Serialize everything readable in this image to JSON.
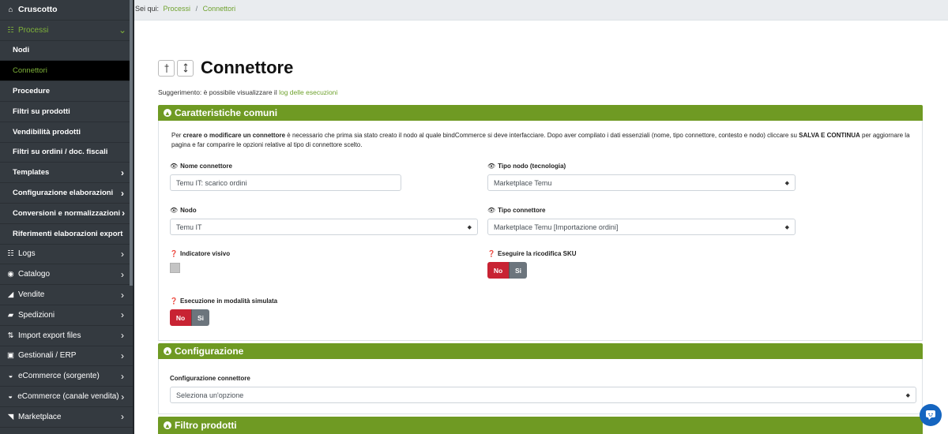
{
  "sidebar": {
    "items": [
      {
        "label": "Cruscotto",
        "icon": "home-icon",
        "glyph": "⌂",
        "kind": "top",
        "chevron": ""
      },
      {
        "label": "Processi",
        "icon": "processes-icon",
        "glyph": "☷",
        "kind": "open",
        "chevron": "⌄"
      },
      {
        "label": "Nodi",
        "kind": "sub",
        "chevron": ""
      },
      {
        "label": "Connettori",
        "kind": "sub-active",
        "chevron": ""
      },
      {
        "label": "Procedure",
        "kind": "sub",
        "chevron": ""
      },
      {
        "label": "Filtri su prodotti",
        "kind": "sub",
        "chevron": ""
      },
      {
        "label": "Vendibilità prodotti",
        "kind": "sub",
        "chevron": ""
      },
      {
        "label": "Filtri su ordini / doc. fiscali",
        "kind": "sub",
        "chevron": ""
      },
      {
        "label": "Templates",
        "kind": "sub",
        "chevron": "›"
      },
      {
        "label": "Configurazione elaborazioni",
        "kind": "sub",
        "chevron": "›"
      },
      {
        "label": "Conversioni e normalizzazioni",
        "kind": "sub",
        "chevron": "›"
      },
      {
        "label": "Riferimenti elaborazioni export",
        "kind": "sub",
        "chevron": ""
      },
      {
        "label": "Logs",
        "icon": "logs-icon",
        "glyph": "☷",
        "kind": "mid",
        "chevron": "›"
      },
      {
        "label": "Catalogo",
        "icon": "catalog-icon",
        "glyph": "◉",
        "kind": "mid",
        "chevron": "›"
      },
      {
        "label": "Vendite",
        "icon": "sales-chart-icon",
        "glyph": "◢",
        "kind": "mid",
        "chevron": "›"
      },
      {
        "label": "Spedizioni",
        "icon": "shipping-icon",
        "glyph": "▰",
        "kind": "mid",
        "chevron": "›"
      },
      {
        "label": "Import export files",
        "icon": "import-export-icon",
        "glyph": "⇅",
        "kind": "mid",
        "chevron": "›"
      },
      {
        "label": "Gestionali / ERP",
        "icon": "erp-icon",
        "glyph": "▣",
        "kind": "mid",
        "chevron": "›"
      },
      {
        "label": "eCommerce (sorgente)",
        "icon": "cart-icon",
        "glyph": "◒",
        "kind": "mid",
        "chevron": "›"
      },
      {
        "label": "eCommerce (canale vendita)",
        "icon": "cart-icon",
        "glyph": "◒",
        "kind": "mid",
        "chevron": "›"
      },
      {
        "label": "Marketplace",
        "icon": "marketplace-icon",
        "glyph": "◥",
        "kind": "mid",
        "chevron": "›"
      }
    ]
  },
  "breadcrumb": {
    "prefix": "Sei qui:",
    "items": [
      "Processi",
      "Connettori"
    ],
    "separator": "/"
  },
  "page": {
    "title": "Connettore",
    "hint_prefix": "Suggerimento: è possibile visualizzare il",
    "hint_link": "log delle esecuzioni"
  },
  "sections": {
    "common_title": "Caratteristiche comuni",
    "config_title": "Configurazione",
    "filter_title": "Filtro prodotti"
  },
  "description": {
    "p1": "Per ",
    "b1": "creare o modificare un connettore",
    "p2": " è necessario che prima sia stato creato il nodo al quale bindCommerce si deve interfacciare. Dopo aver compilato i dati essenziali (nome, tipo connettore, contesto e nodo) cliccare su ",
    "b2": "SALVA E CONTINUA",
    "p3": " per aggiornare la pagina e far comparire le opzioni relative al tipo di connettore scelto."
  },
  "form": {
    "name_label": "Nome connettore",
    "name_value": "Temu IT: scarico ordini",
    "node_type_label": "Tipo nodo (tecnologia)",
    "node_type_value": "Marketplace Temu",
    "node_label": "Nodo",
    "node_value": "Temu IT",
    "connector_type_label": "Tipo connettore",
    "connector_type_value": "Marketplace Temu [Importazione ordini]",
    "visual_indicator_label": "Indicatore visivo",
    "sku_recode_label": "Eseguire la ricodifica SKU",
    "simulated_label": "Esecuzione in modalità simulata",
    "no_label": "No",
    "si_label": "Si",
    "config_label": "Configurazione connettore",
    "config_placeholder": "Seleziona un'opzione"
  },
  "colors": {
    "sidebar_bg": "#343a40",
    "accent_green": "#6f9a23",
    "link_green": "#6fa22e",
    "no_red": "#c82333",
    "si_gray": "#6c757d",
    "chat_blue": "#1565c0"
  }
}
